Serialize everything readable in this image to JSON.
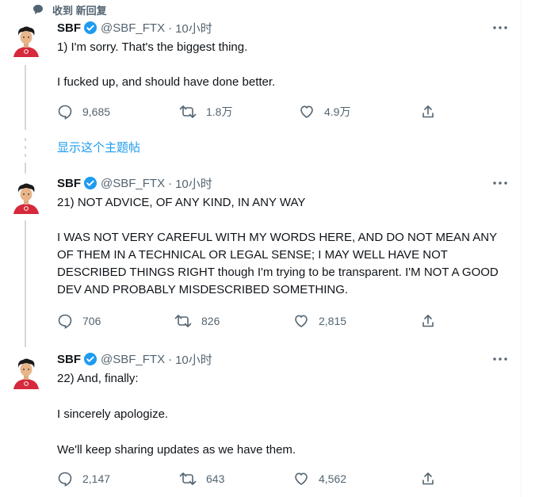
{
  "context": {
    "label": "收到 新回复",
    "icon": "speech-bubble-icon"
  },
  "show_thread": "显示这个主题帖",
  "user": {
    "name": "SBF",
    "handle": "@SBF_FTX",
    "separator": "·",
    "time": "10小时"
  },
  "tweets": [
    {
      "paragraphs": [
        "1) I'm sorry.  That's the biggest thing.",
        "I fucked up, and should have done better."
      ],
      "replies": "9,685",
      "retweets": "1.8万",
      "likes": "4.9万"
    },
    {
      "paragraphs": [
        "21) NOT ADVICE, OF ANY KIND, IN ANY WAY",
        "I WAS NOT VERY CAREFUL WITH MY WORDS HERE, AND DO NOT MEAN ANY OF THEM IN A TECHNICAL OR LEGAL SENSE; I MAY WELL HAVE NOT DESCRIBED THINGS RIGHT though I'm trying to be transparent.  I'M NOT A GOOD DEV AND PROBABLY MISDESCRIBED SOMETHING."
      ],
      "replies": "706",
      "retweets": "826",
      "likes": "2,815"
    },
    {
      "paragraphs": [
        "22) And, finally:",
        "I sincerely apologize.",
        "We'll keep sharing updates as we have them."
      ],
      "replies": "2,147",
      "retweets": "643",
      "likes": "4,562"
    }
  ],
  "colors": {
    "accent": "#1d9bf0",
    "text": "#0f1419",
    "muted": "#536471",
    "line": "#cfd9de",
    "avatar_shirt": "#d6293b"
  }
}
